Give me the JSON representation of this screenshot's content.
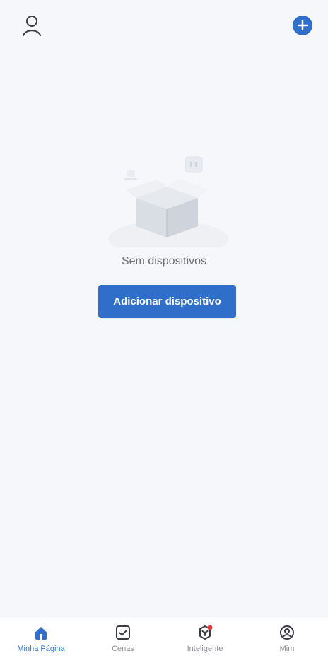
{
  "colors": {
    "accent": "#2f6fca",
    "background": "#f6f7fa",
    "muted_text": "#6b6f76",
    "nav_inactive": "#8b8f96",
    "badge": "#e53935"
  },
  "top_bar": {
    "left_icon": "user-profile-icon",
    "right_icon": "plus-circle-icon"
  },
  "empty_state": {
    "message": "Sem dispositivos",
    "button_label": "Adicionar dispositivo",
    "illustration_icon": "empty-box-illustration"
  },
  "bottom_nav": {
    "items": [
      {
        "label": "Minha Página",
        "icon": "home-icon",
        "active": true
      },
      {
        "label": "Cenas",
        "icon": "checkbox-icon",
        "active": false
      },
      {
        "label": "Inteligente",
        "icon": "smart-cube-icon",
        "active": false,
        "badge": true
      },
      {
        "label": "Mim",
        "icon": "profile-circle-icon",
        "active": false
      }
    ]
  }
}
